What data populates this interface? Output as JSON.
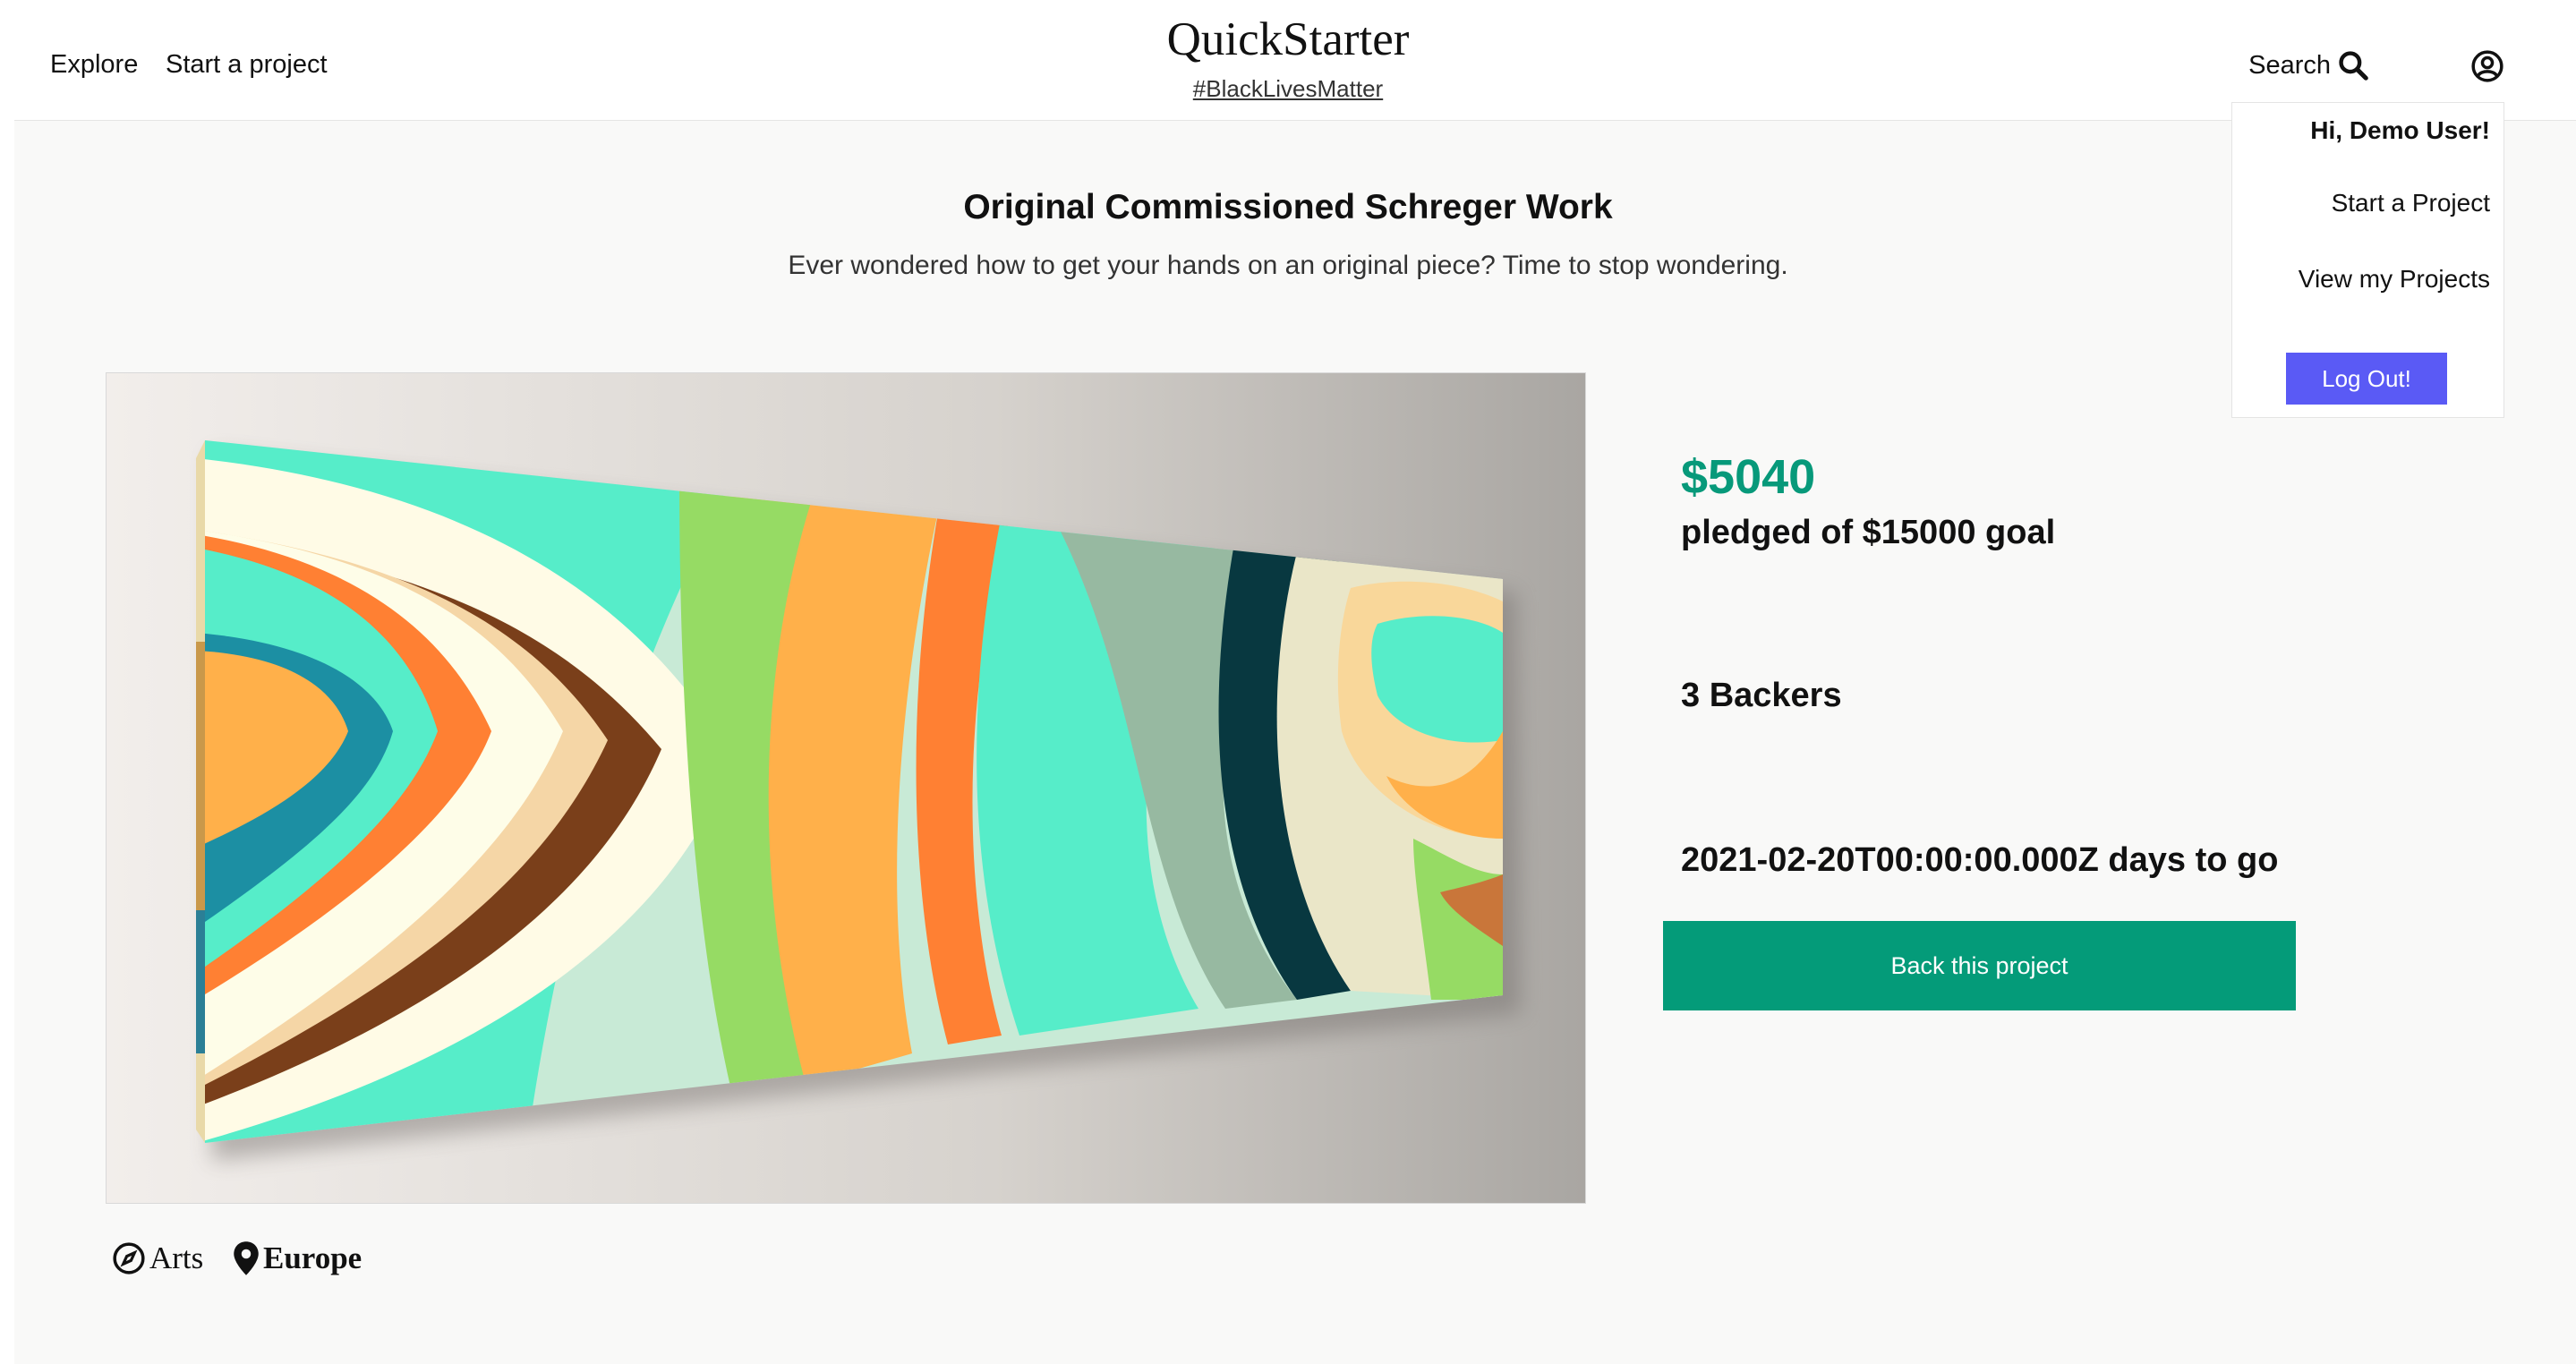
{
  "header": {
    "nav": {
      "explore": "Explore",
      "start_project": "Start a project"
    },
    "brand": "QuickStarter",
    "tagline": "#BlackLivesMatter",
    "search_label": "Search"
  },
  "user_menu": {
    "greeting": "Hi, Demo User!",
    "start_project": "Start a Project",
    "view_projects": "View my Projects",
    "logout": "Log Out!"
  },
  "project": {
    "title": "Original Commissioned Schreger Work",
    "blurb": "Ever wondered how to get your hands on an original piece? Time to stop wondering.",
    "pledged": "$5040",
    "goal_text": "pledged of $15000 goal",
    "backers_text": "3 Backers",
    "deadline_text": "2021-02-20T00:00:00.000Z days to go",
    "back_button": "Back this project",
    "category": "Arts",
    "location": "Europe"
  },
  "colors": {
    "accent_green": "#049b79",
    "pledged_green": "#07997a",
    "logout_purple": "#5a5af5"
  },
  "icons": {
    "search": "search-icon",
    "user": "user-circle-icon",
    "category": "compass-icon",
    "location": "map-pin-icon"
  }
}
